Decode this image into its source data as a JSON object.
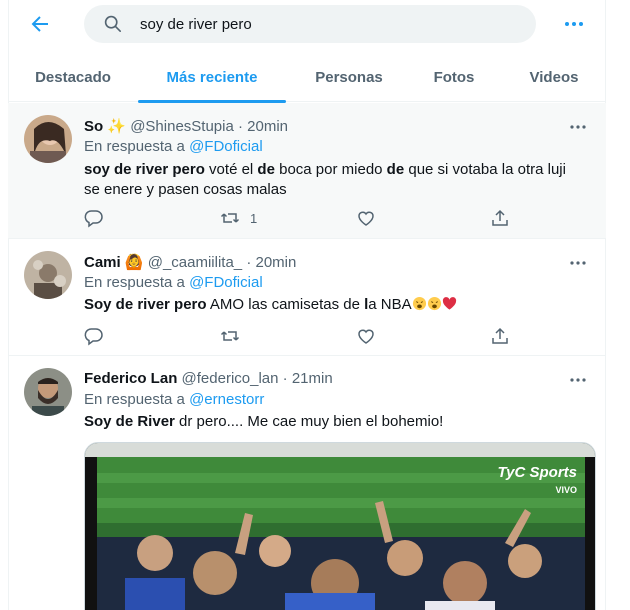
{
  "search": {
    "query": "soy de river pero"
  },
  "tabs": [
    {
      "label": "Destacado"
    },
    {
      "label": "Más reciente"
    },
    {
      "label": "Personas"
    },
    {
      "label": "Fotos"
    },
    {
      "label": "Videos"
    }
  ],
  "tweets": [
    {
      "name": "So",
      "handle": "@ShinesStupia",
      "time": "20min",
      "reply_prefix": "En respuesta a ",
      "reply_to": "@FDoficial",
      "text_parts": [
        "soy de river pero",
        " voté el ",
        "de",
        " boca por miedo ",
        "de",
        " que si votaba la otra luji se enere y pasen cosas malas"
      ],
      "retweets": "1"
    },
    {
      "name": "Cami",
      "handle": "@_caamiilita_",
      "time": "20min",
      "reply_prefix": "En respuesta a ",
      "reply_to": "@FDoficial",
      "text_parts": [
        "Soy de river pero",
        " AMO las camisetas de ",
        "l",
        "a NBA"
      ]
    },
    {
      "name": "Federico Lan",
      "handle": "@federico_lan",
      "time": "21min",
      "reply_prefix": "En respuesta a ",
      "reply_to": "@ernestorr",
      "text_parts": [
        "Soy de River",
        " dr pero.... Me cae muy bien el bohemio!"
      ],
      "media_logo": "TyC Sports",
      "media_live": "VIVO"
    }
  ],
  "colors": {
    "accent": "#1d9bf0",
    "muted": "#536471",
    "highlight_bg": "#f7f9f9"
  }
}
